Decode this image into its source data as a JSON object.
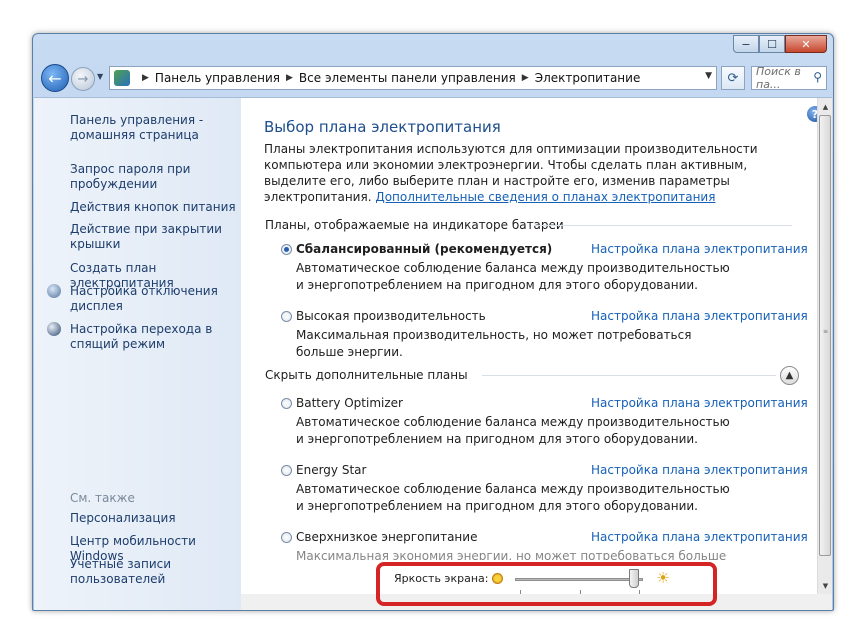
{
  "window": {
    "caption_buttons": {
      "minimize": "−",
      "maximize": "☐",
      "close": "✕"
    }
  },
  "navbar": {
    "back_icon": "arrow-left-icon",
    "breadcrumbs": [
      "Панель управления",
      "Все элементы панели управления",
      "Электропитание"
    ],
    "search_placeholder": "Поиск в па..."
  },
  "sidebar": {
    "links": [
      "Панель управления - домашняя страница",
      "Запрос пароля при пробуждении",
      "Действия кнопок питания",
      "Действие при закрытии крышки",
      "Создать план электропитания",
      "Настройка отключения дисплея",
      "Настройка перехода в спящий режим"
    ],
    "see_also_label": "См. также",
    "see_also": [
      "Персонализация",
      "Центр мобильности Windows",
      "Учетные записи пользователей"
    ]
  },
  "main": {
    "title": "Выбор плана электропитания",
    "description": "Планы электропитания используются для оптимизации производительности компьютера или экономии электроэнергии. Чтобы сделать план активным, выделите его, либо выберите план и настройте его, изменив параметры электропитания.",
    "description_link": "Дополнительные сведения о планах электропитания",
    "section_battery": "Планы, отображаемые на индикаторе батареи",
    "section_hidden": "Скрыть дополнительные планы",
    "configure_label": "Настройка плана электропитания",
    "plans": [
      {
        "name": "Сбалансированный (рекомендуется)",
        "desc": "Автоматическое соблюдение баланса между производительностью и энергопотреблением на пригодном для этого оборудовании.",
        "selected": true
      },
      {
        "name": "Высокая производительность",
        "desc": "Максимальная производительность, но может потребоваться больше энергии.",
        "selected": false
      },
      {
        "name": "Battery Optimizer",
        "desc": "Автоматическое соблюдение баланса между производительностью и энергопотреблением на пригодном для этого оборудовании.",
        "selected": false
      },
      {
        "name": "Energy Star",
        "desc": "Автоматическое соблюдение баланса между производительностью и энергопотреблением на пригодном для этого оборудовании.",
        "selected": false
      },
      {
        "name": "Сверхнизкое энергопитание",
        "desc": "Максимальная экономия энергии, но может потребоваться больше энергии.",
        "selected": false
      }
    ]
  },
  "brightness": {
    "label": "Яркость экрана:",
    "level_percent": 97
  }
}
